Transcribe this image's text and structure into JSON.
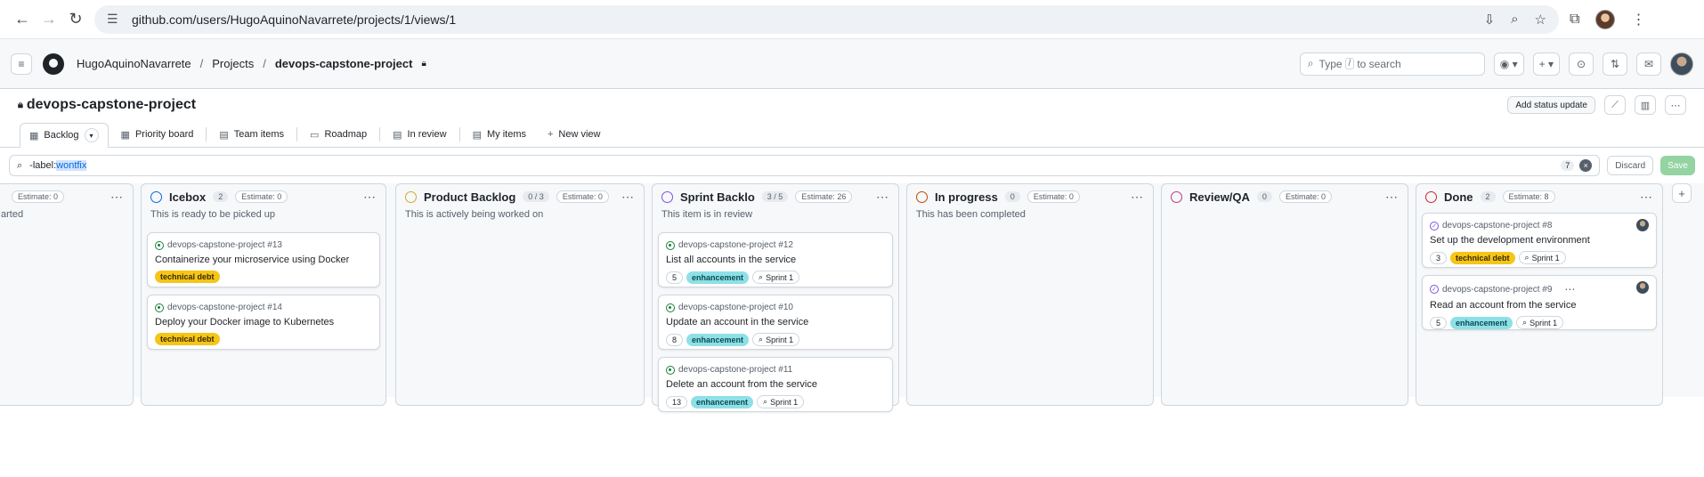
{
  "browser": {
    "url": "github.com/users/HugoAquinoNavarrete/projects/1/views/1"
  },
  "header": {
    "crumbs": [
      "HugoAquinoNavarrete",
      "Projects",
      "devops-capstone-project"
    ],
    "search_placeholder_pre": "Type",
    "search_key": "/",
    "search_placeholder_post": "to search"
  },
  "project": {
    "title": "devops-capstone-project",
    "status_button": "Add status update"
  },
  "tabs": [
    {
      "label": "Backlog"
    },
    {
      "label": "Priority board"
    },
    {
      "label": "Team items"
    },
    {
      "label": "Roadmap"
    },
    {
      "label": "In review"
    },
    {
      "label": "My items"
    },
    {
      "label": "New view"
    }
  ],
  "filter": {
    "query_prefix": "-label:",
    "query_value": "wontfix",
    "count": "7",
    "discard": "Discard",
    "save": "Save"
  },
  "columns": [
    {
      "name": "",
      "count": "",
      "estimate": "Estimate: 0",
      "desc": "arted",
      "color": "#8c959f"
    },
    {
      "name": "Icebox",
      "count": "2",
      "estimate": "Estimate: 0",
      "desc": "This is ready to be picked up",
      "color": "#0969da"
    },
    {
      "name": "Product Backlog",
      "count": "0 / 3",
      "estimate": "Estimate: 0",
      "desc": "This is actively being worked on",
      "color": "#d4a72c"
    },
    {
      "name": "Sprint Backlo",
      "count": "3 / 5",
      "estimate": "Estimate: 26",
      "desc": "This item is in review",
      "color": "#8250df"
    },
    {
      "name": "In progress",
      "count": "0",
      "estimate": "Estimate: 0",
      "desc": "This has been completed",
      "color": "#bc4c00"
    },
    {
      "name": "Review/QA",
      "count": "0",
      "estimate": "Estimate: 0",
      "desc": "",
      "color": "#bf3989"
    },
    {
      "name": "Done",
      "count": "2",
      "estimate": "Estimate: 8",
      "desc": "",
      "color": "#cf222e"
    }
  ],
  "cards": {
    "icebox": [
      {
        "ref": "devops-capstone-project #13",
        "title": "Containerize your microservice using Docker",
        "label": "technical debt"
      },
      {
        "ref": "devops-capstone-project #14",
        "title": "Deploy your Docker image to Kubernetes",
        "label": "technical debt"
      }
    ],
    "sprint": [
      {
        "ref": "devops-capstone-project #12",
        "title": "List all accounts in the service",
        "points": "5",
        "label": "enhancement",
        "sprint": "Sprint 1"
      },
      {
        "ref": "devops-capstone-project #10",
        "title": "Update an account in the service",
        "points": "8",
        "label": "enhancement",
        "sprint": "Sprint 1"
      },
      {
        "ref": "devops-capstone-project #11",
        "title": "Delete an account from the service",
        "points": "13",
        "label": "enhancement",
        "sprint": "Sprint 1"
      }
    ],
    "done": [
      {
        "ref": "devops-capstone-project #8",
        "title": "Set up the development environment",
        "points": "3",
        "label": "technical debt",
        "sprint": "Sprint 1"
      },
      {
        "ref": "devops-capstone-project #9",
        "title": "Read an account from the service",
        "points": "5",
        "label": "enhancement",
        "sprint": "Sprint 1"
      }
    ]
  }
}
